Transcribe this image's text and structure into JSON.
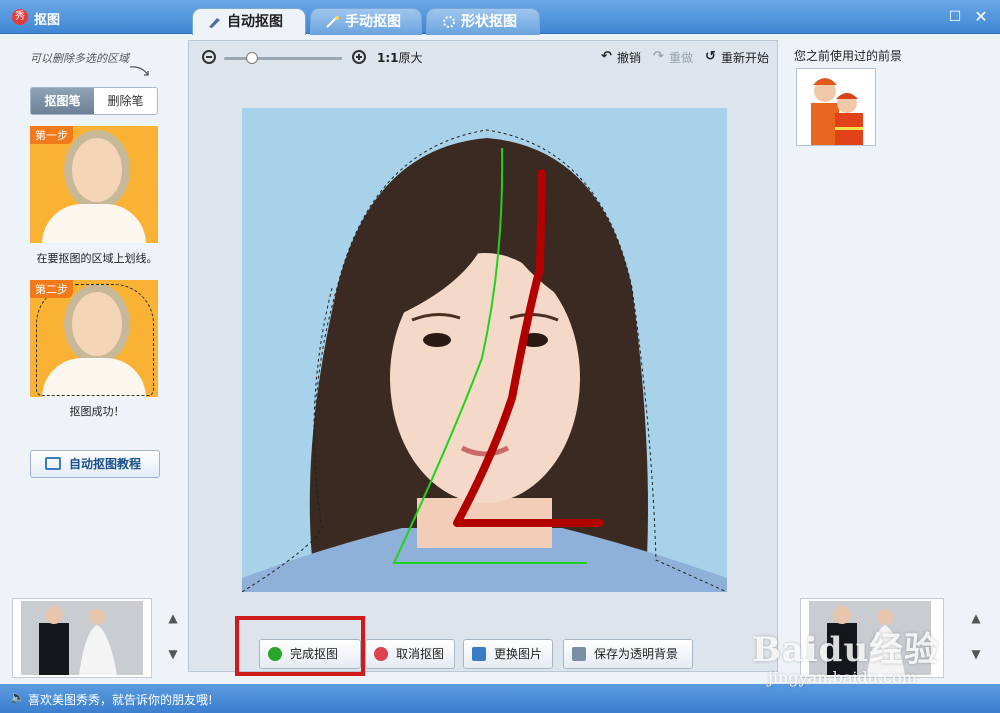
{
  "window": {
    "title": "抠图"
  },
  "tabs": [
    {
      "label": "自动抠图"
    },
    {
      "label": "手动抠图"
    },
    {
      "label": "形状抠图"
    }
  ],
  "left_panel": {
    "hint": "可以删除多选的区域",
    "segment": {
      "pen": "抠图笔",
      "eraser": "删除笔"
    },
    "step1": {
      "tag": "第一步",
      "caption": "在要抠图的区域上划线。"
    },
    "step2": {
      "tag": "第二步",
      "caption": "抠图成功！"
    },
    "tutorial_label": "自动抠图教程"
  },
  "toolbar": {
    "ratio_bold": "1:1",
    "ratio_label": "原大",
    "undo": "撤销",
    "redo": "重做",
    "restart": "重新开始"
  },
  "bottom_buttons": {
    "finish": "完成抠图",
    "cancel": "取消抠图",
    "change": "更换图片",
    "save_transparent": "保存为透明背景"
  },
  "right_panel": {
    "title": "您之前使用过的前景"
  },
  "statusbar": {
    "message": "喜欢美图秀秀，就告诉你的朋友哦!"
  },
  "watermark": {
    "main": "Baidu经验",
    "sub": "jingyan.baidu.com"
  },
  "colors": {
    "highlight": "#d11b1b",
    "stroke_green": "#22d11b",
    "stroke_red": "#b30000",
    "photo_bg": "#a7d2ea"
  }
}
